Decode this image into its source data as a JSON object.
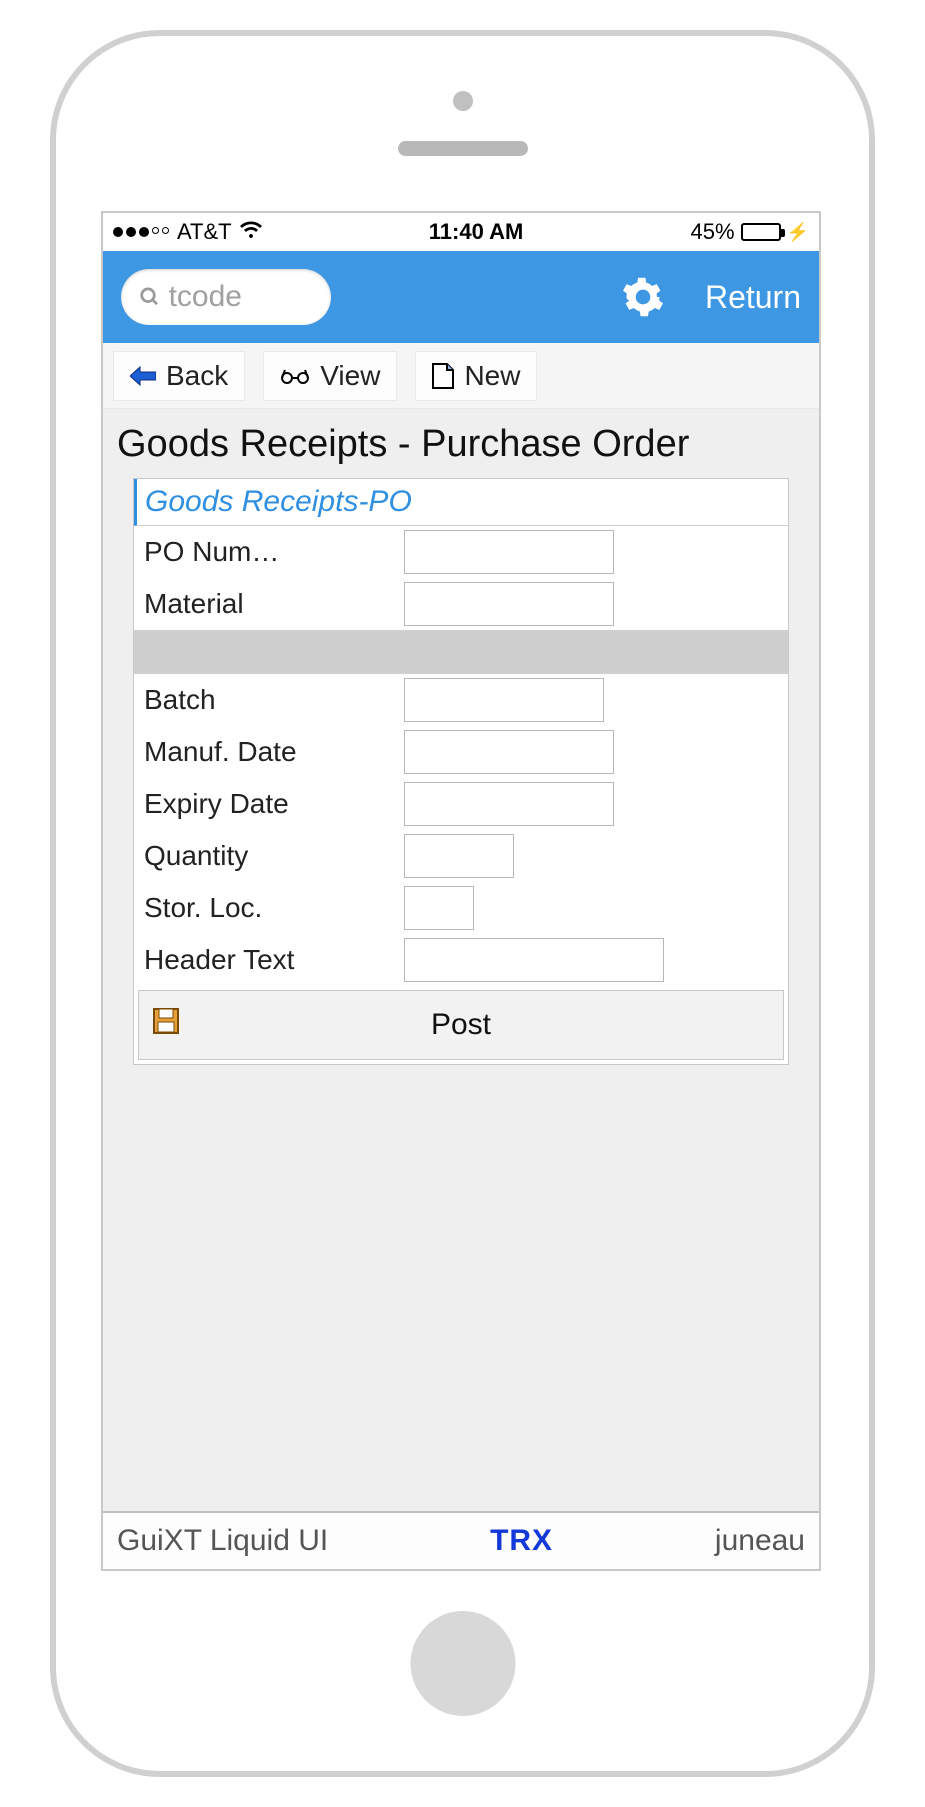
{
  "status": {
    "carrier": "AT&T",
    "time": "11:40 AM",
    "battery_pct": "45%",
    "battery_fill": 45
  },
  "header": {
    "search_placeholder": "tcode",
    "search_value": "",
    "return_label": "Return"
  },
  "toolbar": {
    "back": "Back",
    "view": "View",
    "new": "New"
  },
  "page": {
    "title": "Goods Receipts - Purchase Order"
  },
  "panel": {
    "title": "Goods Receipts-PO",
    "fields": {
      "po_number_label": "PO Num…",
      "po_number_value": "",
      "material_label": "Material",
      "material_value": "",
      "batch_label": "Batch",
      "batch_value": "",
      "manuf_date_label": "Manuf. Date",
      "manuf_date_value": "",
      "expiry_date_label": "Expiry Date",
      "expiry_date_value": "",
      "quantity_label": "Quantity",
      "quantity_value": "",
      "stor_loc_label": "Stor. Loc.",
      "stor_loc_value": "",
      "header_text_label": "Header Text",
      "header_text_value": ""
    },
    "post_label": "Post"
  },
  "footer": {
    "brand": "GuiXT Liquid UI",
    "trx": "TRX",
    "server": "juneau"
  }
}
